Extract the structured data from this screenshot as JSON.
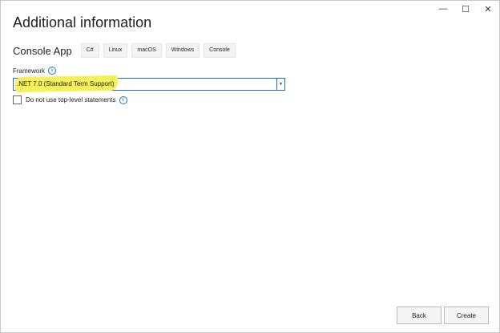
{
  "window": {
    "title": "Additional information",
    "caption_buttons": [
      {
        "name": "minimize-button",
        "glyph": "—"
      },
      {
        "name": "maximize-button",
        "glyph": "☐"
      },
      {
        "name": "close-button",
        "glyph": "✕"
      }
    ]
  },
  "project": {
    "name": "Console App",
    "tags": [
      "C#",
      "Linux",
      "macOS",
      "Windows",
      "Console"
    ]
  },
  "framework": {
    "label": "Framework",
    "info_icon": "info-icon",
    "selected": ".NET 7.0 (Standard Term Support)",
    "highlight_color": "#f6f05a"
  },
  "options": {
    "top_level_statements_label": "Do not use top-level statements",
    "top_level_statements_checked": false
  },
  "buttons": {
    "back": "Back",
    "create": "Create"
  },
  "colors": {
    "accent": "#1a73c8"
  }
}
